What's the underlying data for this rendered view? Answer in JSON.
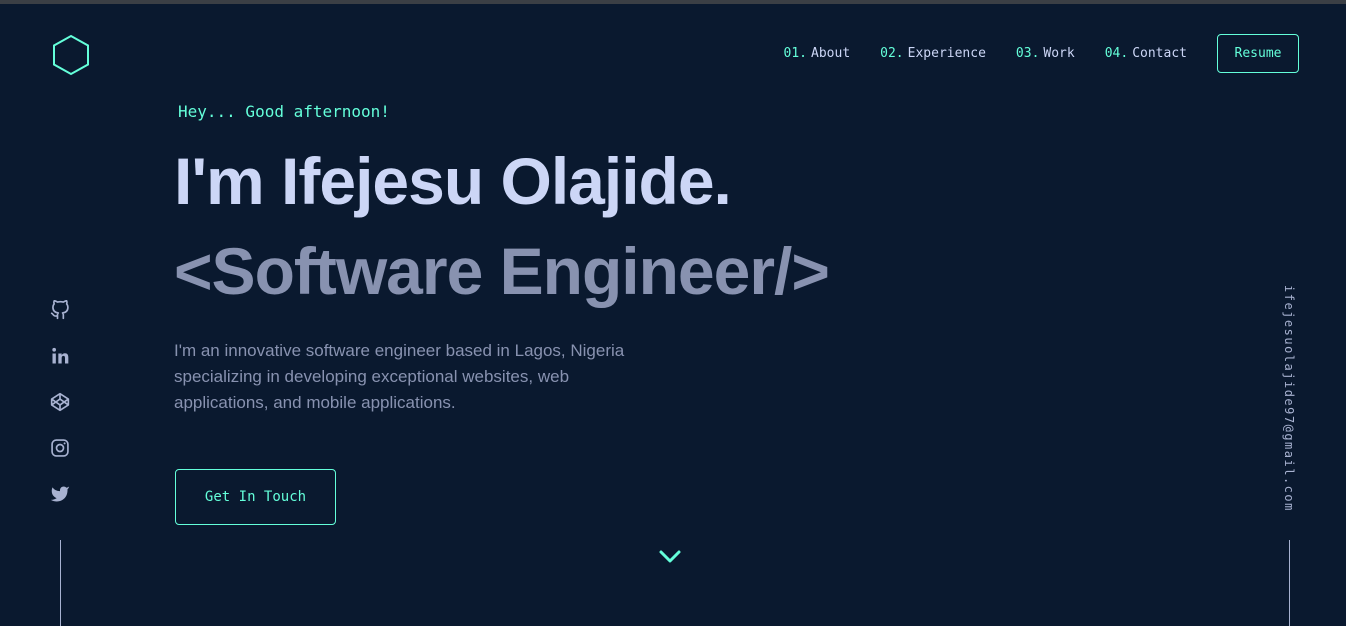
{
  "header": {
    "logo_icon": "hexagon-icon",
    "nav": [
      {
        "num": "01.",
        "label": "About"
      },
      {
        "num": "02.",
        "label": "Experience"
      },
      {
        "num": "03.",
        "label": "Work"
      },
      {
        "num": "04.",
        "label": "Contact"
      }
    ],
    "resume_label": "Resume"
  },
  "hero": {
    "greeting": "Hey... Good afternoon!",
    "name": "I'm Ifejesu Olajide.",
    "role": "<Software Engineer/>",
    "intro": "I'm an innovative software engineer based in Lagos, Nigeria specializing in developing exceptional websites, web applications, and mobile applications.",
    "cta_label": "Get In Touch"
  },
  "socials": [
    "github-icon",
    "linkedin-icon",
    "codepen-icon",
    "instagram-icon",
    "twitter-icon"
  ],
  "email": "ifejesuolajide97@gmail.com",
  "scroll_icon": "chevron-down-icon",
  "colors": {
    "background": "#0a192f",
    "accent": "#64ffda",
    "heading": "#ccd6f6",
    "muted": "#8892b0"
  }
}
